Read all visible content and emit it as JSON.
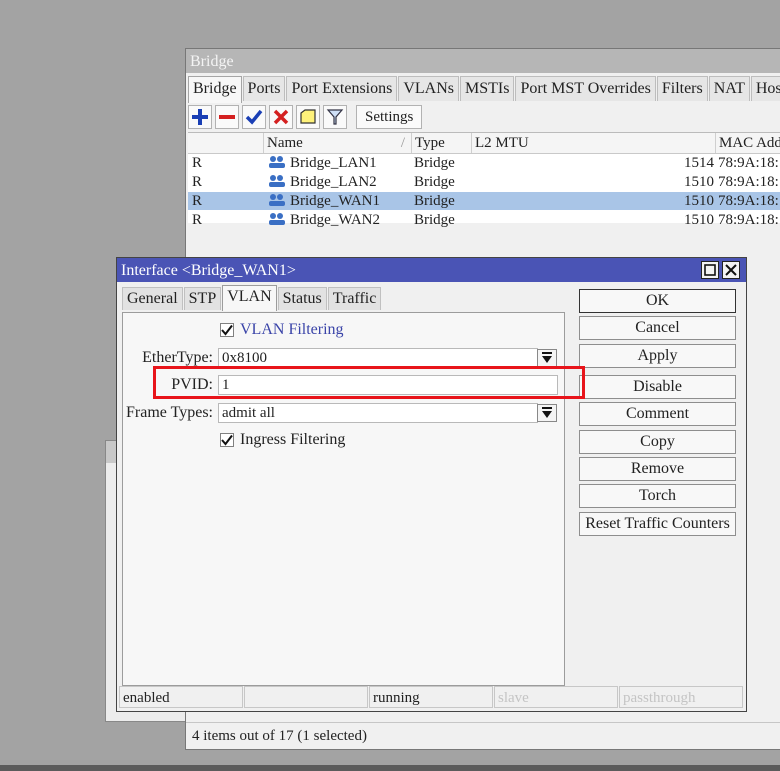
{
  "bridge_window": {
    "title": "Bridge",
    "tabs": [
      "Bridge",
      "Ports",
      "Port Extensions",
      "VLANs",
      "MSTIs",
      "Port MST Overrides",
      "Filters",
      "NAT",
      "Hosts"
    ],
    "settings_label": "Settings",
    "columns": {
      "name": "Name",
      "type": "Type",
      "l2mtu": "L2 MTU",
      "mac": "MAC Add"
    },
    "rows": [
      {
        "flag": "R",
        "name": "Bridge_LAN1",
        "type": "Bridge",
        "l2mtu": "1514",
        "mac": "78:9A:18:"
      },
      {
        "flag": "R",
        "name": "Bridge_LAN2",
        "type": "Bridge",
        "l2mtu": "1510",
        "mac": "78:9A:18:"
      },
      {
        "flag": "R",
        "name": "Bridge_WAN1",
        "type": "Bridge",
        "l2mtu": "1510",
        "mac": "78:9A:18:"
      },
      {
        "flag": "R",
        "name": "Bridge_WAN2",
        "type": "Bridge",
        "l2mtu": "1510",
        "mac": "78:9A:18:"
      }
    ],
    "selected_row": 2,
    "status": "4 items out of 17 (1 selected)"
  },
  "dialog": {
    "title": "Interface <Bridge_WAN1>",
    "tabs": [
      "General",
      "STP",
      "VLAN",
      "Status",
      "Traffic"
    ],
    "active_tab": "VLAN",
    "vlan_filtering_label": "VLAN Filtering",
    "vlan_filtering_checked": true,
    "ethertype_label": "EtherType:",
    "ethertype_value": "0x8100",
    "pvid_label": "PVID:",
    "pvid_value": "1",
    "frame_types_label": "Frame Types:",
    "frame_types_value": "admit all",
    "ingress_filtering_label": "Ingress Filtering",
    "ingress_filtering_checked": true,
    "buttons": {
      "ok": "OK",
      "cancel": "Cancel",
      "apply": "Apply",
      "disable": "Disable",
      "comment": "Comment",
      "copy": "Copy",
      "remove": "Remove",
      "torch": "Torch",
      "reset": "Reset Traffic Counters"
    },
    "status": {
      "enabled": "enabled",
      "running": "running",
      "slave": "slave",
      "passthrough": "passthrough"
    }
  },
  "colors": {
    "title_bar": "#4a54b5",
    "selected_row": "#a9c5e7",
    "highlight": "#e8141a"
  }
}
